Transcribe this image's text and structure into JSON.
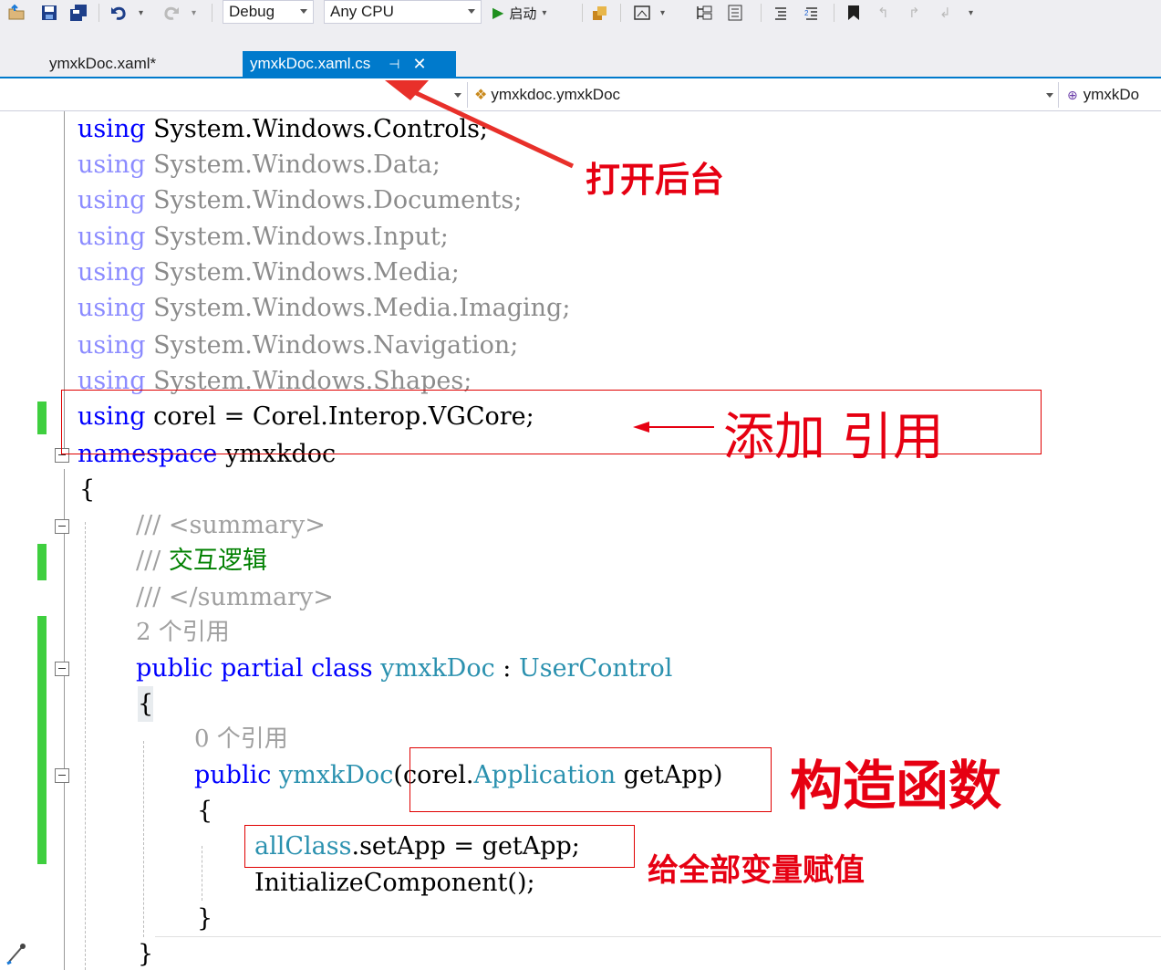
{
  "toolbar": {
    "config": "Debug",
    "platform": "Any CPU",
    "start_label": "启动"
  },
  "tabs": [
    {
      "label": "ymxkDoc.xaml*"
    },
    {
      "label": "ymxkDoc.xaml.cs"
    }
  ],
  "navbar": {
    "class_path": "ymxkdoc.ymxkDoc",
    "member": "ymxkDo"
  },
  "code": {
    "using_kw": "using",
    "ns_controls": "System.Windows.Controls;",
    "ns_data": "System.Windows.Data;",
    "ns_documents": "System.Windows.Documents;",
    "ns_input": "System.Windows.Input;",
    "ns_media": "System.Windows.Media;",
    "ns_imaging": "System.Windows.Media.Imaging;",
    "ns_navigation": "System.Windows.Navigation;",
    "ns_shapes": "System.Windows.Shapes;",
    "corel_using": "corel = Corel.Interop.VGCore;",
    "namespace_kw": "namespace",
    "namespace_name": "ymxkdoc",
    "open_brace": "{",
    "close_brace": "}",
    "summary_open": "/// <summary>",
    "summary_text_prefix": "/// ",
    "summary_text": "交互逻辑",
    "summary_close": "/// </summary>",
    "refs_class": "2 个引用",
    "class_public": "public",
    "class_partial": "partial",
    "class_kw": "class",
    "class_name": "ymxkDoc",
    "class_colon": " : ",
    "class_base": "UserControl",
    "refs_ctor": "0 个引用",
    "ctor_public": "public",
    "ctor_name": "ymxkDoc",
    "ctor_paren_open": "(",
    "ctor_param_ns": "corel.",
    "ctor_param_type": "Application",
    "ctor_param_name": " getApp",
    "ctor_paren_close": ")",
    "assign_obj": "allClass",
    "assign_rest": ".setApp = getApp;",
    "init_call": "InitializeComponent();"
  },
  "annotations": {
    "open_backend": "打开后台",
    "add_reference": "添加 引用",
    "constructor": "构造函数",
    "assign_global": "给全部变量赋值"
  },
  "colors": {
    "accent": "#007acc",
    "keyword": "#0000ff",
    "type": "#2b91af",
    "comment": "#008000",
    "annotation": "#e60012",
    "change_bar": "#3fcf3f"
  }
}
